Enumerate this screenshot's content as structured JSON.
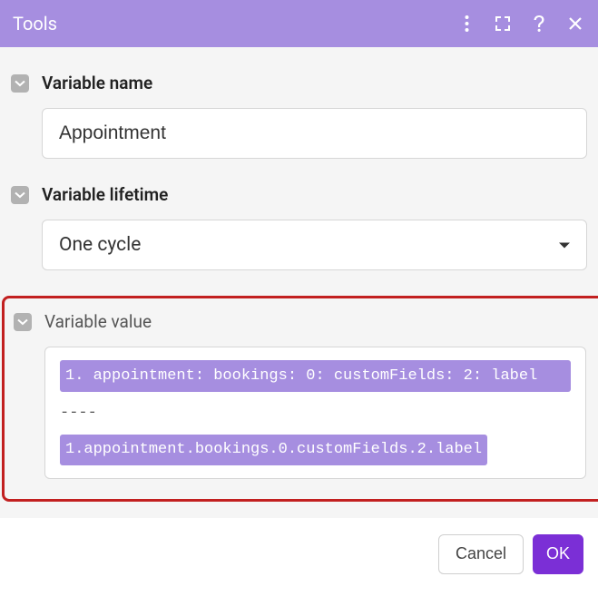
{
  "header": {
    "title": "Tools"
  },
  "fields": {
    "variable_name": {
      "label": "Variable name",
      "value": "Appointment"
    },
    "variable_lifetime": {
      "label": "Variable lifetime",
      "value": "One cycle"
    },
    "variable_value": {
      "label": "Variable value",
      "line1": "1. appointment: bookings: 0: customFields: 2: label",
      "divider": "----",
      "line2": "1.appointment.bookings.0.customFields.2.label"
    }
  },
  "footer": {
    "cancel": "Cancel",
    "ok": "OK"
  }
}
